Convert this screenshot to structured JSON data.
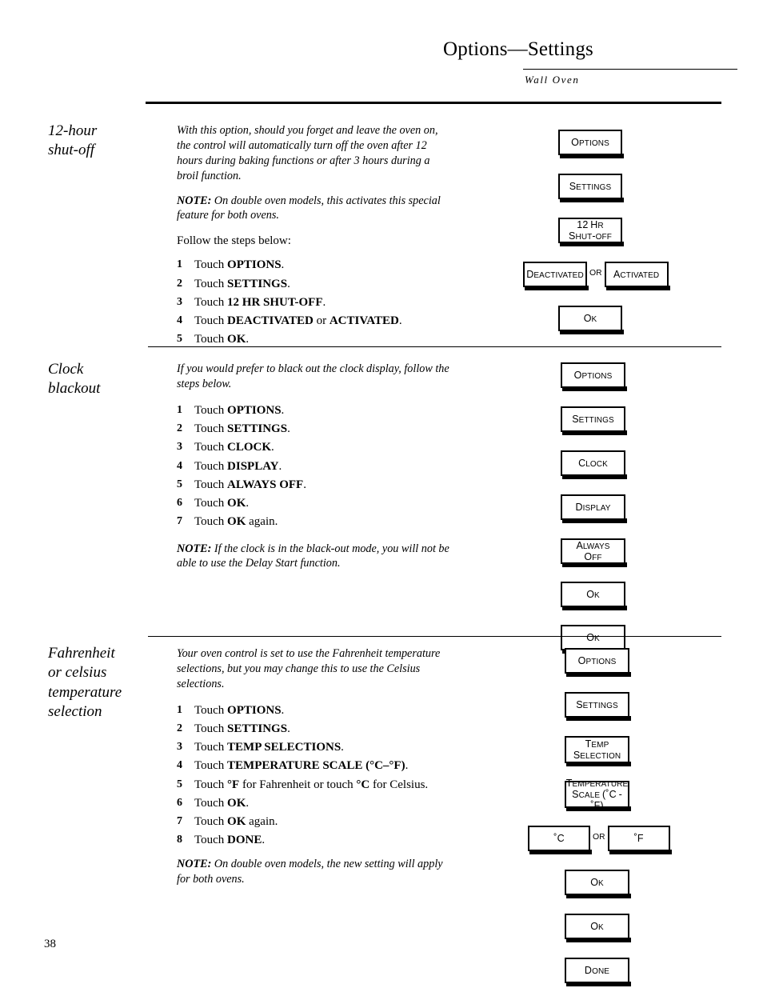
{
  "header": {
    "title": "Options—Settings",
    "subtitle": "Wall Oven"
  },
  "page_number": "38",
  "sections": [
    {
      "id": "twelve-hour-shutoff",
      "heading": "12-hour\nshut-off",
      "intro": "With this option, should you forget and leave the oven on, the control will automatically turn off the oven after 12 hours during baking functions or after 3 hours during a broil function.",
      "note_label": "NOTE:",
      "note_text": " On double oven models, this activates this special feature for both ovens.",
      "follow_text": "Follow the steps below:",
      "steps": [
        {
          "num": "1",
          "prefix": "Touch ",
          "bold": "OPTIONS",
          "suffix": "."
        },
        {
          "num": "2",
          "prefix": "Touch ",
          "bold": "SETTINGS",
          "suffix": "."
        },
        {
          "num": "3",
          "prefix": "Touch ",
          "bold": "12 HR SHUT-OFF",
          "suffix": "."
        },
        {
          "num": "4",
          "prefix": "Touch ",
          "bold": "DEACTIVATED",
          "mid": " or ",
          "bold2": "ACTIVATED",
          "suffix": "."
        },
        {
          "num": "5",
          "prefix": "Touch ",
          "bold": "OK",
          "suffix": "."
        }
      ],
      "keys": [
        {
          "label": "OPTIONS"
        },
        {
          "label": "SETTINGS"
        },
        {
          "label": "12 HR\nSHUT-OFF"
        },
        {
          "label": "DEACTIVATED",
          "or_label": "OR",
          "label2": "ACTIVATED"
        },
        {
          "label": "OK"
        }
      ]
    },
    {
      "id": "clock-blackout",
      "heading": "Clock\nblackout",
      "intro": "If you would prefer to black out the clock display, follow the steps below.",
      "note_label": "NOTE:",
      "note_text": " If the clock is in the black-out mode, you will not be able to use the Delay Start function.",
      "steps": [
        {
          "num": "1",
          "prefix": "Touch ",
          "bold": "OPTIONS",
          "suffix": "."
        },
        {
          "num": "2",
          "prefix": "Touch ",
          "bold": "SETTINGS",
          "suffix": "."
        },
        {
          "num": "3",
          "prefix": "Touch ",
          "bold": "CLOCK",
          "suffix": "."
        },
        {
          "num": "4",
          "prefix": "Touch ",
          "bold": "DISPLAY",
          "suffix": "."
        },
        {
          "num": "5",
          "prefix": "Touch ",
          "bold": "ALWAYS OFF",
          "suffix": "."
        },
        {
          "num": "6",
          "prefix": "Touch ",
          "bold": "OK",
          "suffix": "."
        },
        {
          "num": "7",
          "prefix": "Touch ",
          "bold": "OK",
          "suffix": " again."
        }
      ],
      "keys": [
        {
          "label": "OPTIONS"
        },
        {
          "label": "SETTINGS"
        },
        {
          "label": "CLOCK"
        },
        {
          "label": "DISPLAY"
        },
        {
          "label": "ALWAYS\nOFF"
        },
        {
          "label": "OK"
        },
        {
          "label": "OK"
        }
      ]
    },
    {
      "id": "fahrenheit-celsius",
      "heading": "Fahrenheit\nor celsius\ntemperature\nselection",
      "intro": "Your oven control is set to use the Fahrenheit temperature selections, but you may change this to use the Celsius selections.",
      "note_label": "NOTE:",
      "note_text": " On double oven models, the new setting will apply for both ovens.",
      "steps": [
        {
          "num": "1",
          "prefix": "Touch ",
          "bold": "OPTIONS",
          "suffix": "."
        },
        {
          "num": "2",
          "prefix": "Touch ",
          "bold": "SETTINGS",
          "suffix": "."
        },
        {
          "num": "3",
          "prefix": "Touch ",
          "bold": "TEMP SELECTIONS",
          "suffix": "."
        },
        {
          "num": "4",
          "prefix": "Touch ",
          "bold": "TEMPERATURE SCALE (°C–°F)",
          "suffix": "."
        },
        {
          "num": "5",
          "prefix": "Touch ",
          "bold": "°F",
          "mid": " for Fahrenheit or touch ",
          "bold2": "°C",
          "suffix": " for Celsius."
        },
        {
          "num": "6",
          "prefix": "Touch ",
          "bold": "OK",
          "suffix": "."
        },
        {
          "num": "7",
          "prefix": "Touch ",
          "bold": "OK",
          "suffix": " again."
        },
        {
          "num": "8",
          "prefix": "Touch ",
          "bold": "DONE",
          "suffix": "."
        }
      ],
      "keys": [
        {
          "label": "OPTIONS"
        },
        {
          "label": "SETTINGS"
        },
        {
          "label": "TEMP\nSELECTION"
        },
        {
          "label": "TEMPERATURE\nSCALE (˚C - ˚F)"
        },
        {
          "label": "˚C",
          "or_label": "OR",
          "label2": "˚F"
        },
        {
          "label": "OK"
        },
        {
          "label": "OK"
        },
        {
          "label": "DONE"
        }
      ]
    }
  ]
}
